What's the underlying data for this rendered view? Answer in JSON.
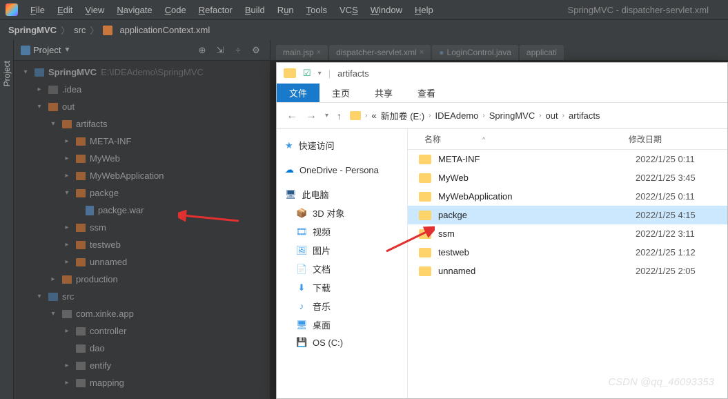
{
  "window_title": "SpringMVC - dispatcher-servlet.xml",
  "menu": [
    "File",
    "Edit",
    "View",
    "Navigate",
    "Code",
    "Refactor",
    "Build",
    "Run",
    "Tools",
    "VCS",
    "Window",
    "Help"
  ],
  "breadcrumb": {
    "project": "SpringMVC",
    "src": "src",
    "file": "applicationContext.xml"
  },
  "sidebar_tab": "Project",
  "panel": {
    "title": "Project"
  },
  "tree": {
    "root": {
      "name": "SpringMVC",
      "path": "E:\\IDEAdemo\\SpringMVC"
    },
    "idea": ".idea",
    "out": "out",
    "artifacts": "artifacts",
    "meta": "META-INF",
    "myweb": "MyWeb",
    "mywebapp": "MyWebApplication",
    "packge": "packge",
    "packge_war": "packge.war",
    "ssm": "ssm",
    "testweb": "testweb",
    "unnamed": "unnamed",
    "production": "production",
    "src": "src",
    "pkg_root": "com.xinke.app",
    "controller": "controller",
    "dao": "dao",
    "entify": "entify",
    "mapping": "mapping"
  },
  "editor_tabs": [
    "main.jsp",
    "dispatcher-servlet.xml",
    "LoginControl.java",
    "applicati"
  ],
  "explorer": {
    "title": "artifacts",
    "ribbon": [
      "文件",
      "主页",
      "共享",
      "查看"
    ],
    "address": {
      "prefix": "«",
      "segs": [
        "新加卷 (E:)",
        "IDEAdemo",
        "SpringMVC",
        "out",
        "artifacts"
      ]
    },
    "quick": {
      "quick_access": "快速访问",
      "onedrive": "OneDrive - Persona",
      "this_pc": "此电脑",
      "items": [
        "3D 对象",
        "视频",
        "图片",
        "文档",
        "下载",
        "音乐",
        "桌面",
        "OS (C:)"
      ]
    },
    "columns": {
      "name": "名称",
      "date": "修改日期"
    },
    "rows": [
      {
        "name": "META-INF",
        "date": "2022/1/25 0:11"
      },
      {
        "name": "MyWeb",
        "date": "2022/1/25 3:45"
      },
      {
        "name": "MyWebApplication",
        "date": "2022/1/25 0:11"
      },
      {
        "name": "packge",
        "date": "2022/1/25 4:15",
        "sel": true
      },
      {
        "name": "ssm",
        "date": "2022/1/22 3:11"
      },
      {
        "name": "testweb",
        "date": "2022/1/25 1:12"
      },
      {
        "name": "unnamed",
        "date": "2022/1/25 2:05"
      }
    ]
  },
  "watermark": "CSDN @qq_46093353"
}
